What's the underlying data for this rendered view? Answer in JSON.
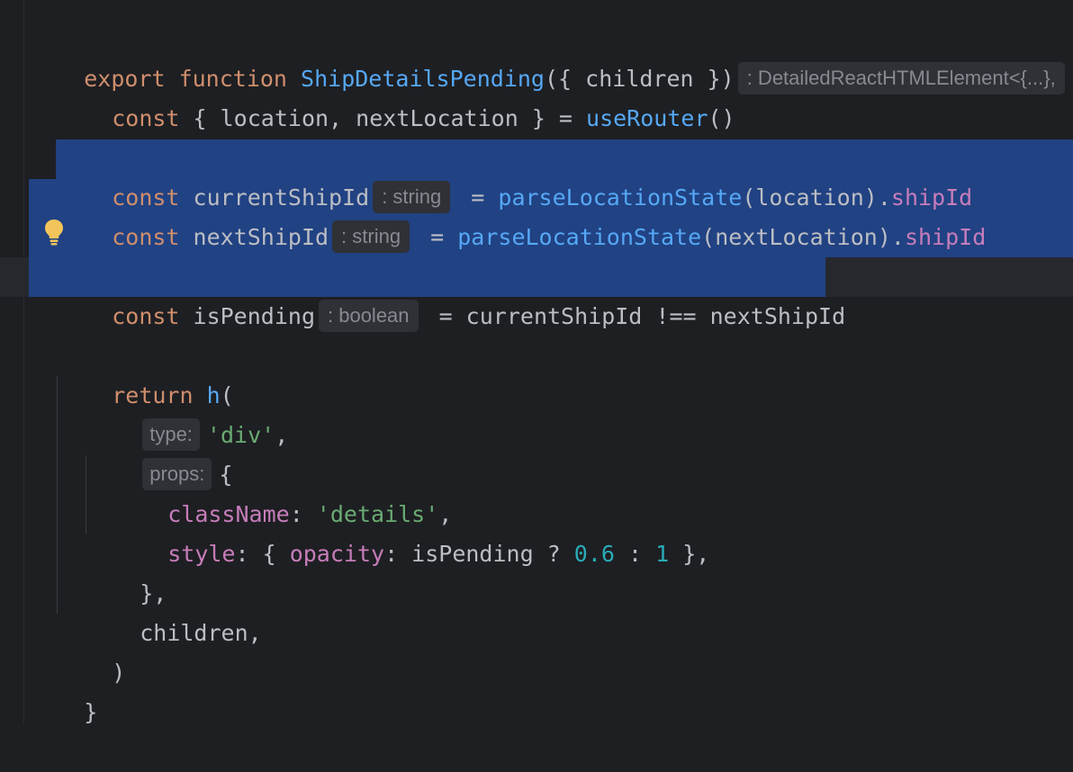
{
  "code": {
    "line1": {
      "export_kw": "export ",
      "function_kw": "function ",
      "fn_name": "ShipDetailsPending",
      "params": "({ children })",
      "hint": ": DetailedReactHTMLElement<{...},"
    },
    "line2": {
      "const_kw": "const ",
      "body": "{ location, nextLocation } = ",
      "fn": "useRouter",
      "tail": "()"
    },
    "line3": {
      "const_kw": "const ",
      "name": "currentShipId",
      "hint": ": string",
      "eq": " = ",
      "fn": "parseLocationState",
      "args": "(location).",
      "prop": "shipId"
    },
    "line4": {
      "const_kw": "const ",
      "name": "nextShipId",
      "hint": ": string",
      "eq": " = ",
      "fn": "parseLocationState",
      "args": "(nextLocation).",
      "prop": "shipId"
    },
    "line5": {
      "const_kw": "const ",
      "name": "isPending",
      "hint": ": boolean",
      "rest": " = currentShipId !== nextShipId"
    },
    "line6": {
      "return_kw": "return ",
      "fn": "h",
      "paren": "("
    },
    "line7": {
      "hint": "type:",
      "str": "'div'",
      "comma": ","
    },
    "line8": {
      "hint": "props:",
      "brace": "{"
    },
    "line9": {
      "prop": "className",
      "colon": ": ",
      "str": "'details'",
      "comma": ","
    },
    "line10": {
      "prop": "style",
      "colon": ": { ",
      "prop2": "opacity",
      "mid": ": isPending ? ",
      "num1": "0.6",
      "sep": " : ",
      "num2": "1",
      "end": " },"
    },
    "line11": {
      "text": "},"
    },
    "line12": {
      "text": "children,"
    },
    "line13": {
      "text": ")"
    },
    "line14": {
      "text": "}"
    }
  },
  "colors": {
    "background": "#1e1f22",
    "selection": "#214283",
    "keyword": "#cf8e6d",
    "function": "#56a8f5",
    "property": "#c77dbb",
    "string": "#6aab73",
    "number": "#2aacb8",
    "text": "#bcbec4"
  },
  "icons": {
    "intention": "lightbulb-icon"
  }
}
